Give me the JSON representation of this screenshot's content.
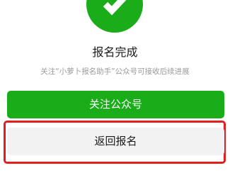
{
  "result": {
    "icon": "success-check-icon",
    "title": "报名完成",
    "subtitle": "关注“小萝卜报名助手”公众号可接收后续进展"
  },
  "actions": {
    "follow_label": "关注公众号",
    "back_label": "返回报名"
  },
  "colors": {
    "success_green": "#1aad19",
    "primary_button": "#1aad19",
    "secondary_button": "#f2f2f2",
    "highlight_border": "#e01e1e"
  }
}
